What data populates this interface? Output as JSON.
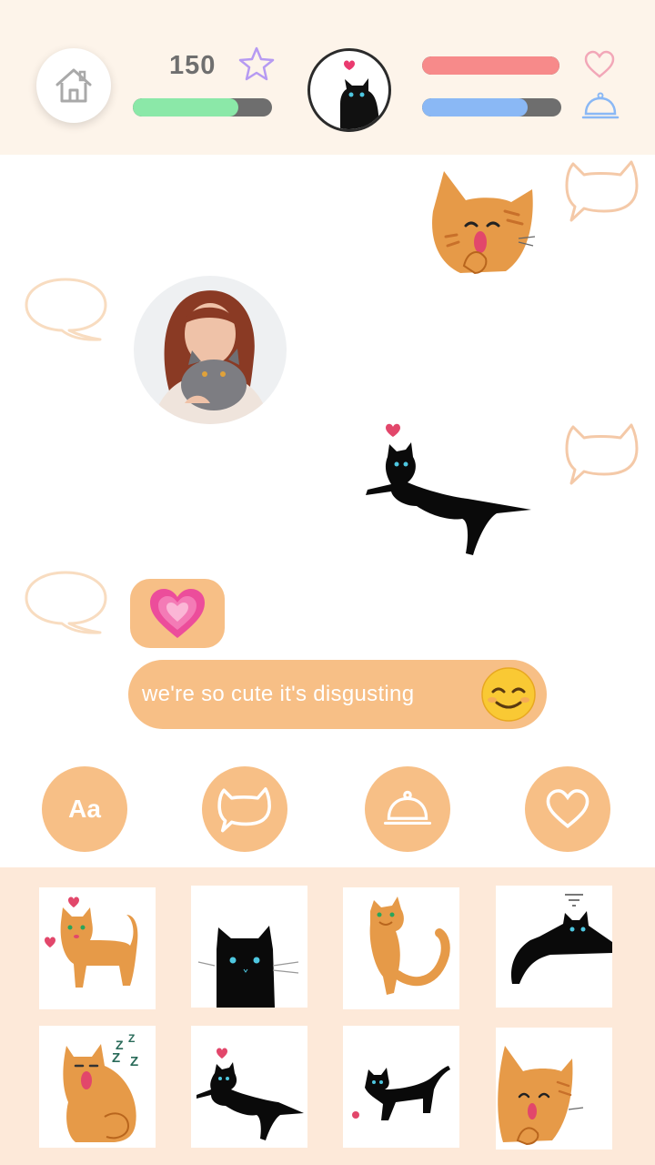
{
  "header": {
    "score": "150",
    "xp_progress": 0.76,
    "health_progress": 1.0,
    "food_progress": 0.76,
    "colors": {
      "xp": "#8be8a8",
      "health": "#f78a8a",
      "food": "#8ab8f5",
      "track": "#6e6e6e"
    },
    "icons": [
      "home-icon",
      "star-icon",
      "heart-outline-icon",
      "food-cloche-icon"
    ]
  },
  "chat": {
    "text_message": "we're so cute it's disgusting",
    "heart_message": "💗",
    "bubble_color": "#f7bf86"
  },
  "actions": [
    "Aa",
    "cat-speech-icon",
    "food-cloche-icon",
    "heart-outline-icon"
  ],
  "tray": {
    "stickers": [
      "orange-cat-hearts",
      "black-cat-sitting",
      "orange-cat-playing",
      "black-cat-lying",
      "orange-cat-sleeping",
      "black-cat-floating-heart",
      "black-cat-walking-yarn",
      "orange-cat-laughing"
    ]
  }
}
